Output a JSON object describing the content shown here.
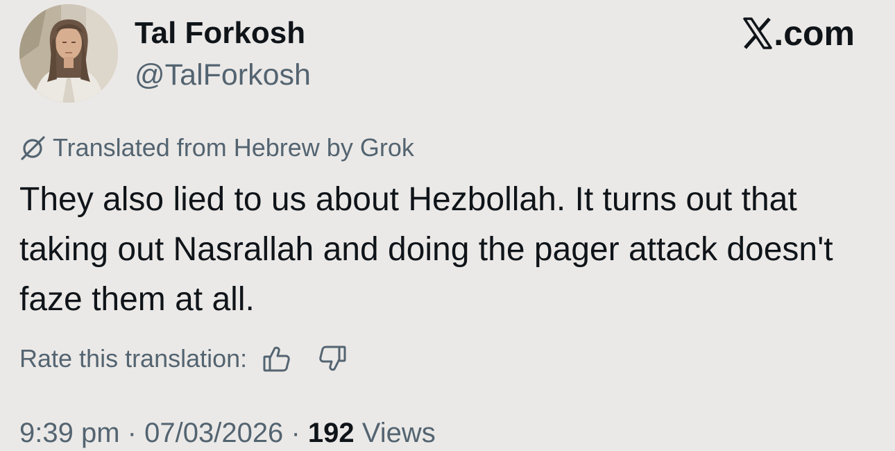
{
  "author": {
    "display_name": "Tal Forkosh",
    "handle": "@TalForkosh",
    "avatar_icon": "profile-photo"
  },
  "brand": {
    "logo_icon": "x-logo-icon",
    "text": ".com"
  },
  "translation": {
    "icon": "grok-icon",
    "label": "Translated from Hebrew by Grok"
  },
  "tweet": {
    "text": "They also lied to us about Hezbollah. It turns out that taking out Nasrallah and doing the pager attack doesn't faze them at all."
  },
  "rating": {
    "label": "Rate this translation:",
    "up_icon": "thumbs-up-icon",
    "down_icon": "thumbs-down-icon"
  },
  "meta": {
    "time": "9:39 pm",
    "separator": "·",
    "date": "07/03/2026",
    "views_count": "192",
    "views_label": "Views"
  },
  "colors": {
    "background": "#ebe9e7",
    "primary_text": "#0f1419",
    "secondary_text": "#536471"
  }
}
